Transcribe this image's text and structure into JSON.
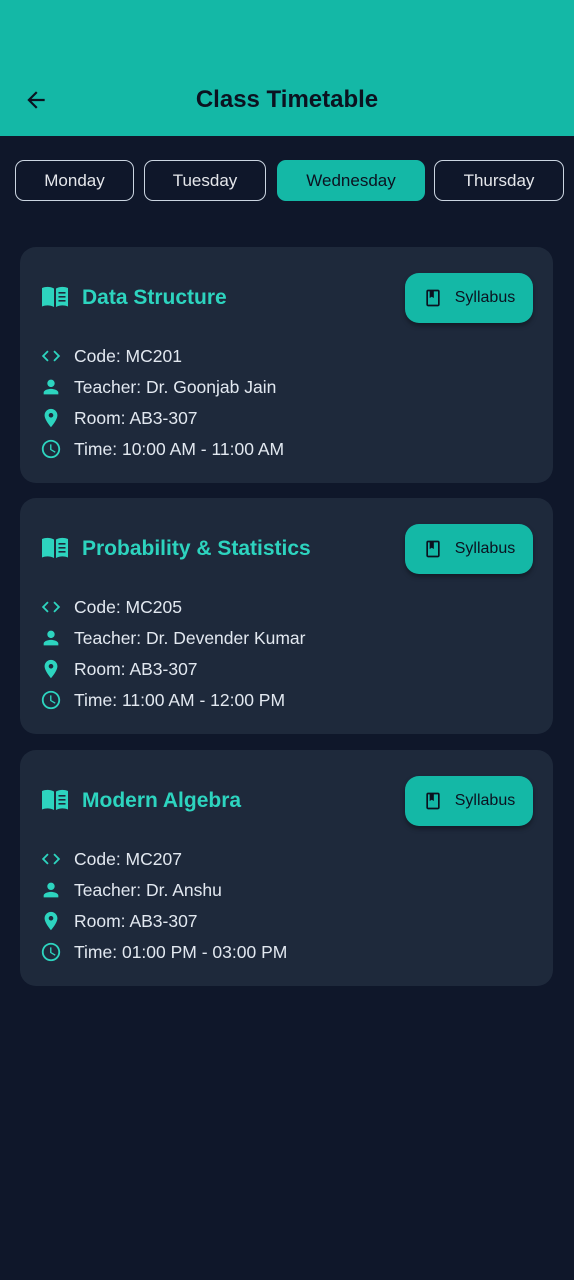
{
  "colors": {
    "accent": "#14b8a6",
    "accent_text": "#2dd4bf",
    "background": "#0f172a",
    "card": "#1e293b"
  },
  "appbar": {
    "back_icon": "arrow-left-icon",
    "title": "Class Timetable"
  },
  "days": [
    {
      "label": "Monday",
      "active": false
    },
    {
      "label": "Tuesday",
      "active": false
    },
    {
      "label": "Wednesday",
      "active": true
    },
    {
      "label": "Thursday",
      "active": false
    }
  ],
  "classes": [
    {
      "title": "Data Structure",
      "button": "Syllabus",
      "code": "Code: MC201",
      "teacher": "Teacher: Dr. Goonjab Jain",
      "room": "Room: AB3-307",
      "time": "Time: 10:00 AM - 11:00 AM"
    },
    {
      "title": "Probability & Statistics",
      "button": "Syllabus",
      "code": "Code: MC205",
      "teacher": "Teacher: Dr. Devender Kumar",
      "room": "Room: AB3-307",
      "time": "Time: 11:00 AM - 12:00 PM"
    },
    {
      "title": "Modern Algebra",
      "button": "Syllabus",
      "code": "Code: MC207",
      "teacher": "Teacher: Dr. Anshu",
      "room": "Room: AB3-307",
      "time": "Time: 01:00 PM - 03:00 PM"
    }
  ],
  "icons": {
    "title": "book-open-icon",
    "button": "book-icon",
    "code": "code-icon",
    "teacher": "person-icon",
    "room": "location-pin-icon",
    "time": "clock-icon"
  }
}
